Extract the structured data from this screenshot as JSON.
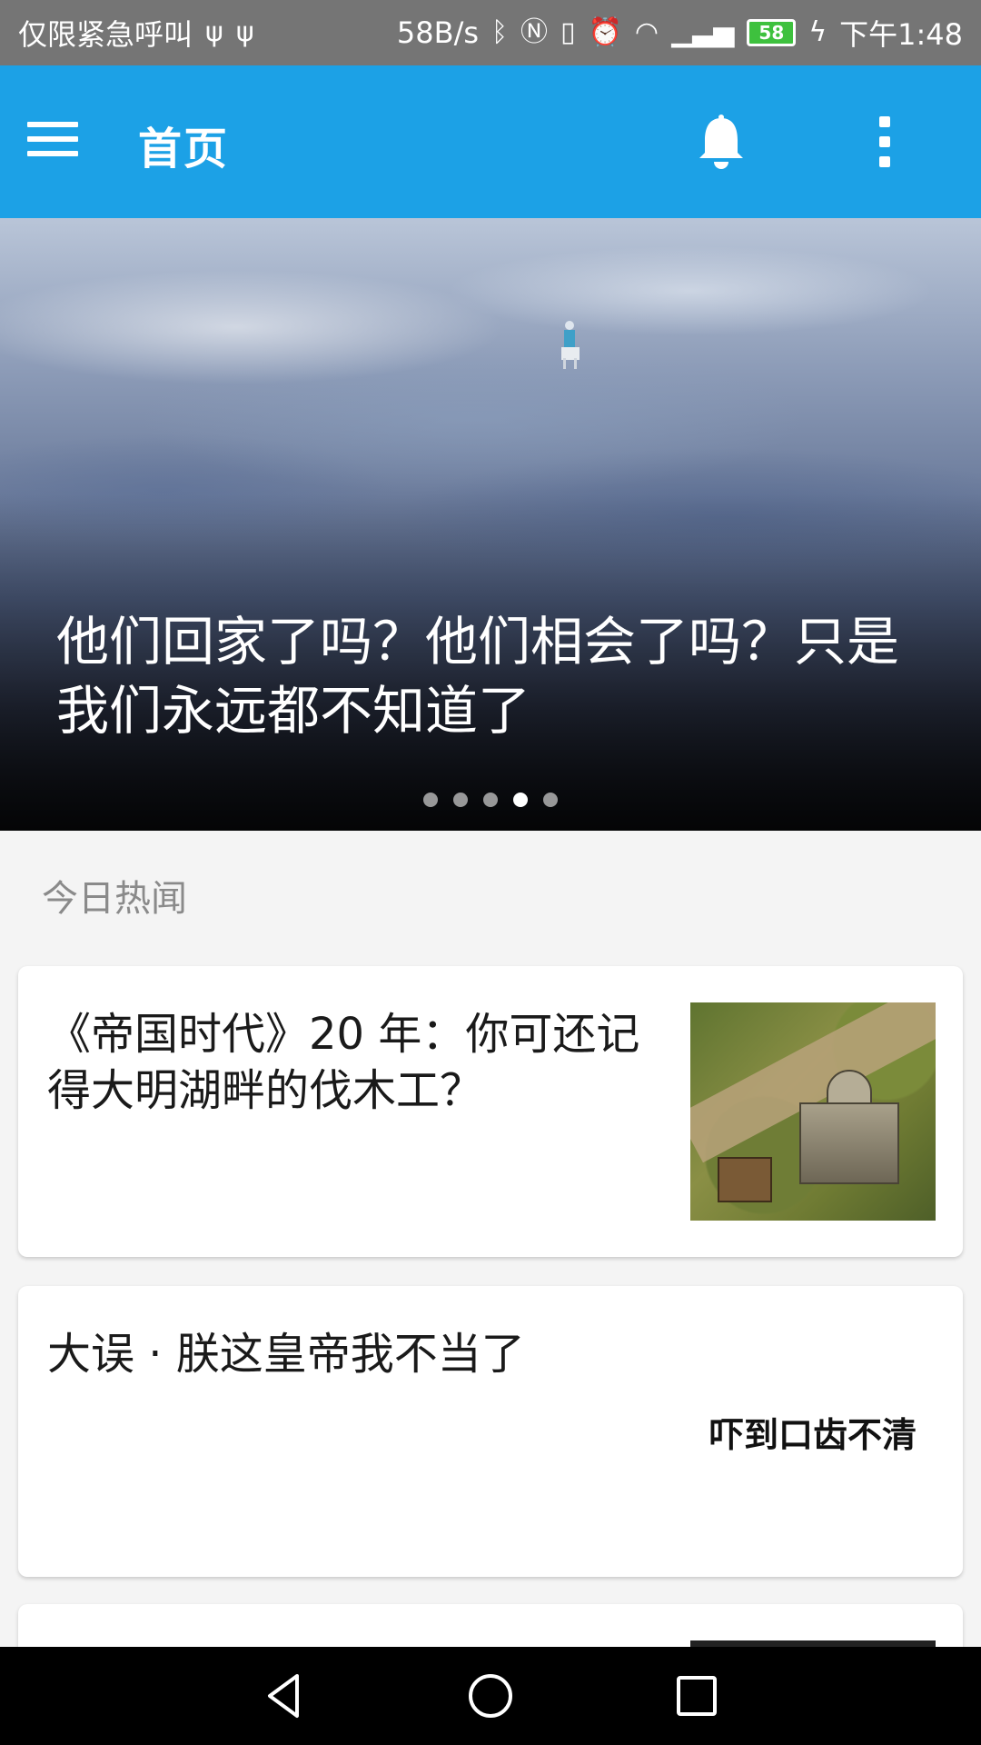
{
  "status_bar": {
    "emergency_text": "仅限紧急呼叫",
    "net_speed": "58B/s",
    "battery_level": "58",
    "time": "下午1:48",
    "icons": [
      "usb-icon",
      "usb-icon",
      "bluetooth-icon",
      "nfc-icon",
      "vibrate-icon",
      "alarm-icon",
      "wifi-icon",
      "signal-icon",
      "battery-icon",
      "charging-icon"
    ]
  },
  "app_bar": {
    "title": "首页",
    "icons": [
      "menu-icon",
      "bell-icon",
      "more-vert-icon"
    ],
    "color": "#1ca1e6"
  },
  "banner": {
    "title": "他们回家了吗？他们相会了吗？只是我们永远都不知道了",
    "page_count": 5,
    "active_page": 4
  },
  "section": {
    "title": "今日热闻"
  },
  "stories": [
    {
      "title": "《帝国时代》20 年：你可还记得大明湖畔的伐木工？",
      "thumb_text": ""
    },
    {
      "title": "大误 · 朕这皇帝我不当了",
      "thumb_text": "吓到口齿不清"
    }
  ],
  "nav_bar": {
    "icons": [
      "back-icon",
      "home-icon",
      "recents-icon"
    ]
  }
}
